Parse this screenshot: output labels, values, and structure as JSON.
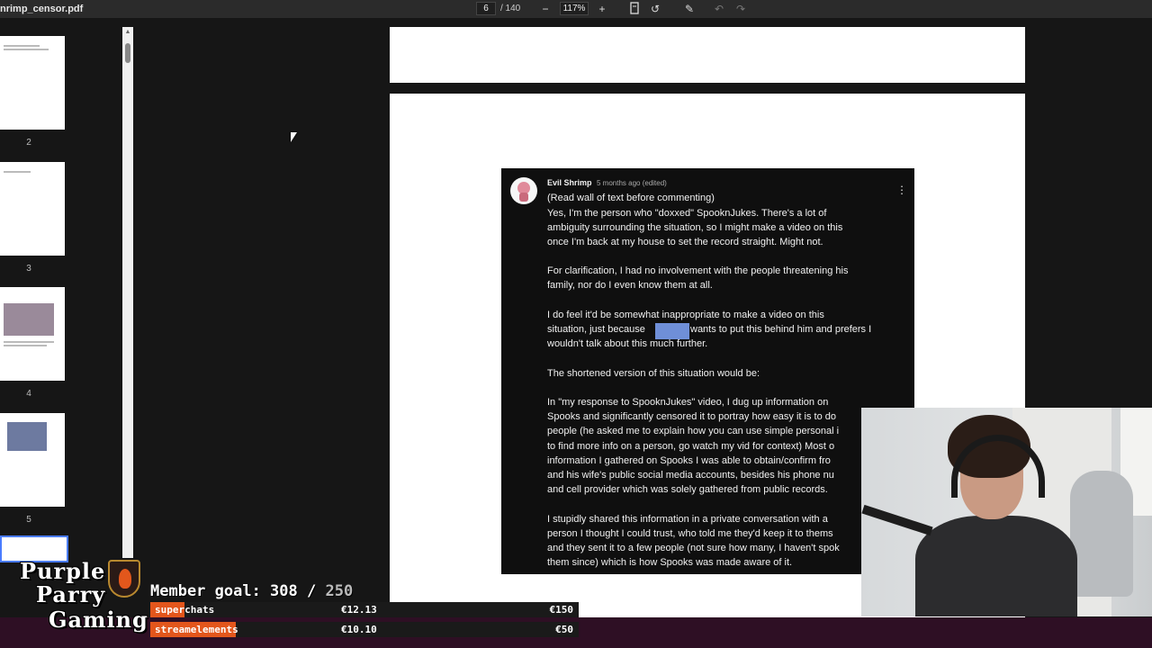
{
  "toolbar": {
    "filename": "nrimp_censor.pdf",
    "page_current": "6",
    "page_total": "/ 140",
    "zoom": "117%",
    "icons": [
      "zoom-out-icon",
      "zoom-in-icon",
      "fit-page-icon",
      "rotate-icon",
      "draw-icon",
      "undo-icon",
      "redo-icon"
    ]
  },
  "sidebar": {
    "thumbnails": [
      {
        "label": "2"
      },
      {
        "label": "3"
      },
      {
        "label": "4"
      },
      {
        "label": "5"
      }
    ]
  },
  "comment": {
    "author": "Evil Shrimp",
    "time": "5 months ago (edited)",
    "lines": [
      "(Read wall of text before commenting)",
      "Yes, I'm the person who \"doxxed\" SpooknJukes. There's a lot of",
      "ambiguity surrounding the situation, so I might make a video on this",
      "once I'm back at my house to set the record straight. Might not.",
      "For clarification, I had no involvement with the people threatening his",
      "family, nor do I even know them at all.",
      "I do feel it'd be somewhat inappropriate to make a video on this",
      "situation, just because",
      "wants to put this behind him and prefers I",
      "wouldn't talk about this much further.",
      "The shortened version of this situation would be:",
      "In \"my response to SpooknJukes\" video, I dug up information on",
      "Spooks and significantly censored it to portray how easy it is to do",
      "people (he asked me to explain how you can use simple personal i",
      "to find more info on a person, go watch my vid for context) Most o",
      "information I gathered on Spooks I was able to obtain/confirm fro",
      "and his wife's public social media accounts, besides his phone nu",
      "and cell provider which was solely gathered from public records.",
      "I stupidly shared this information in a private conversation with a",
      "person I thought I could trust, who told me they'd keep it to thems",
      "and they sent it to a few people (not sure how many, I haven't spok",
      "them since) which is how Spooks was made aware of it."
    ]
  },
  "overlay": {
    "logo_lines": [
      "Purple",
      "Parry",
      "Gaming"
    ],
    "goal_prefix": "Member goal: 308 /",
    "goal_max": " 250",
    "goals": [
      {
        "name": "superchats",
        "current": "€12.13",
        "target": "€150",
        "fill_fraction": 0.08
      },
      {
        "name": "streamelements",
        "current": "€10.10",
        "target": "€50",
        "fill_fraction": 0.2
      }
    ],
    "colors": {
      "accent": "#e3561c",
      "bar_bg": "#2e0f24"
    }
  }
}
